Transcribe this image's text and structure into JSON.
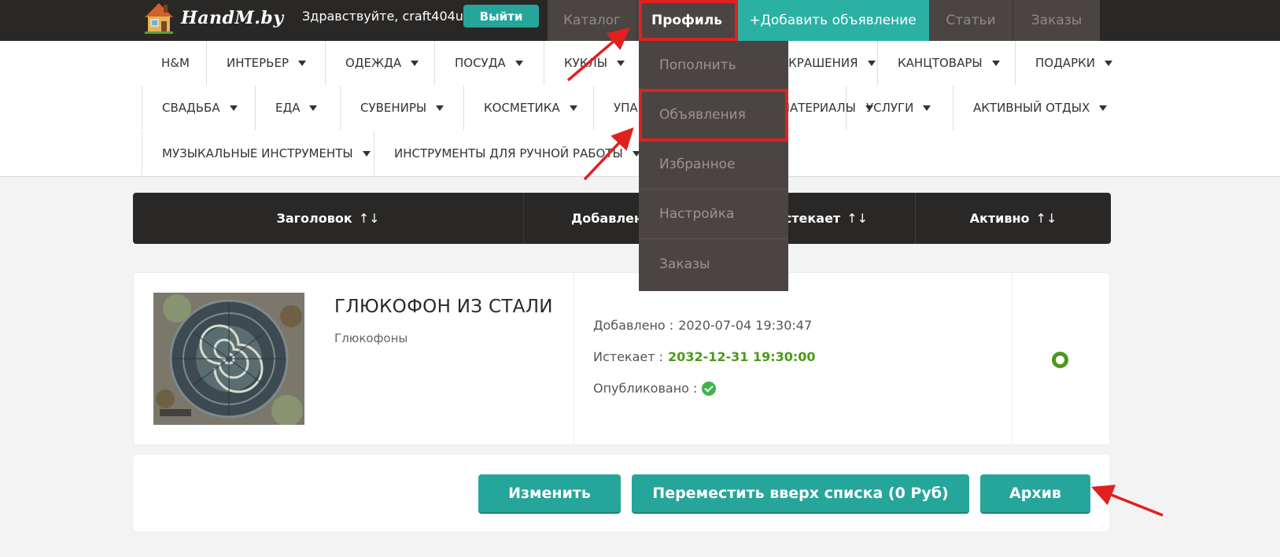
{
  "header": {
    "logo_text": "HandM.by",
    "greeting": "Здравствуйте, craft404u",
    "logout_label": "Выйти",
    "nav": [
      {
        "label": "Каталог"
      },
      {
        "label": "Профиль"
      },
      {
        "label": "+Добавить объявление"
      },
      {
        "label": "Статьи"
      },
      {
        "label": "Заказы"
      }
    ]
  },
  "categories": [
    {
      "label": "H&M"
    },
    {
      "label": "ИНТЕРЬЕР"
    },
    {
      "label": "ОДЕЖДА"
    },
    {
      "label": "ПОСУДА"
    },
    {
      "label": "КУКЛЫ"
    },
    {
      "label": "УКРАШЕНИЯ"
    },
    {
      "label": "КАНЦТОВАРЫ"
    },
    {
      "label": "ПОДАРКИ"
    },
    {
      "label": "СВАДЬБА"
    },
    {
      "label": "ЕДА"
    },
    {
      "label": "СУВЕНИРЫ"
    },
    {
      "label": "КОСМЕТИКА"
    },
    {
      "label": "УПАКОВКА"
    },
    {
      "label": "МАТЕРИАЛЫ"
    },
    {
      "label": "УСЛУГИ"
    },
    {
      "label": "АКТИВНЫЙ ОТДЫХ"
    },
    {
      "label": "МУЗЫКАЛЬНЫЕ ИНСТРУМЕНТЫ"
    },
    {
      "label": "ИНСТРУМЕНТЫ ДЛЯ РУЧНОЙ РАБОТЫ"
    }
  ],
  "profile_menu": [
    {
      "label": "Пополнить"
    },
    {
      "label": "Объявления"
    },
    {
      "label": "Избранное"
    },
    {
      "label": "Настройка"
    },
    {
      "label": "Заказы"
    }
  ],
  "table": {
    "columns": [
      {
        "label": "Заголовок",
        "sort": "↑↓"
      },
      {
        "label": "Добавлено",
        "sort": "↑↓"
      },
      {
        "label": "Истекает",
        "sort": "↑↓"
      },
      {
        "label": "Активно",
        "sort": "↑↓"
      }
    ]
  },
  "ad": {
    "title": "ГЛЮКОФОН ИЗ СТАЛИ",
    "category": "Глюкофоны",
    "added_label": "Добавлено :",
    "added_value": "2020-07-04 19:30:47",
    "expires_label": "Истекает :",
    "expires_value": "2032-12-31 19:30:00",
    "published_label": "Опубликовано :",
    "published": true,
    "active": true
  },
  "actions": {
    "edit_label": "Изменить",
    "bump_label": "Переместить вверх списка (0 Руб)",
    "archive_label": "Архив"
  },
  "colors": {
    "accent": "#26a69a",
    "dark": "#2a2826",
    "annotation": "#e02020",
    "success": "#4a9a1a"
  }
}
